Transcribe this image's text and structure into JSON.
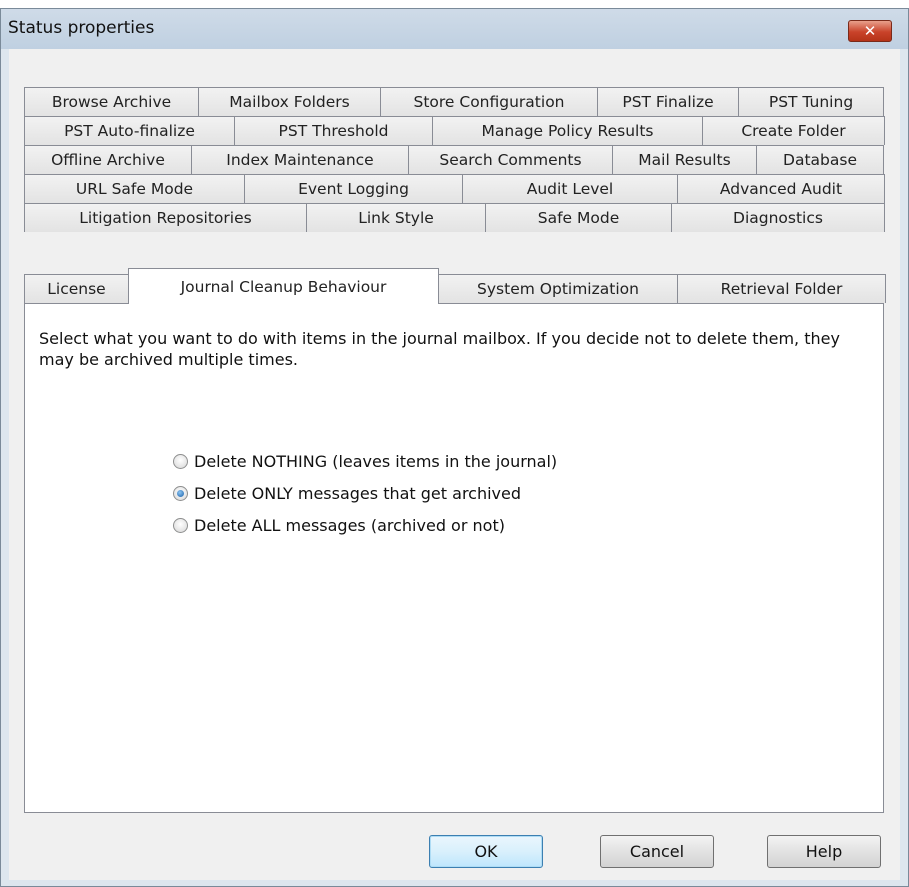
{
  "dialog": {
    "title": "Status properties",
    "close_glyph": "✕"
  },
  "tabs": {
    "row1": [
      "Browse Archive",
      "Mailbox Folders",
      "Store Configuration",
      "PST Finalize",
      "PST Tuning"
    ],
    "row2": [
      "PST Auto-finalize",
      "PST Threshold",
      "Manage Policy Results",
      "Create Folder"
    ],
    "row3": [
      "Offline Archive",
      "Index Maintenance",
      "Search Comments",
      "Mail Results",
      "Database"
    ],
    "row4": [
      "URL Safe Mode",
      "Event Logging",
      "Audit Level",
      "Advanced Audit"
    ],
    "row5": [
      "Litigation Repositories",
      "Link Style",
      "Safe Mode",
      "Diagnostics"
    ],
    "row6": [
      "License",
      "Journal Cleanup Behaviour",
      "System Optimization",
      "Retrieval Folder"
    ],
    "selected": "Journal Cleanup Behaviour"
  },
  "panel": {
    "description": "Select what you want to do with items in the journal mailbox. If you decide not to delete them, they may be archived multiple times.",
    "options": [
      {
        "label": "Delete NOTHING (leaves items in the journal)",
        "checked": false
      },
      {
        "label": "Delete ONLY messages that get archived",
        "checked": true
      },
      {
        "label": "Delete ALL messages (archived or not)",
        "checked": false
      }
    ]
  },
  "buttons": {
    "ok": "OK",
    "cancel": "Cancel",
    "help": "Help"
  }
}
